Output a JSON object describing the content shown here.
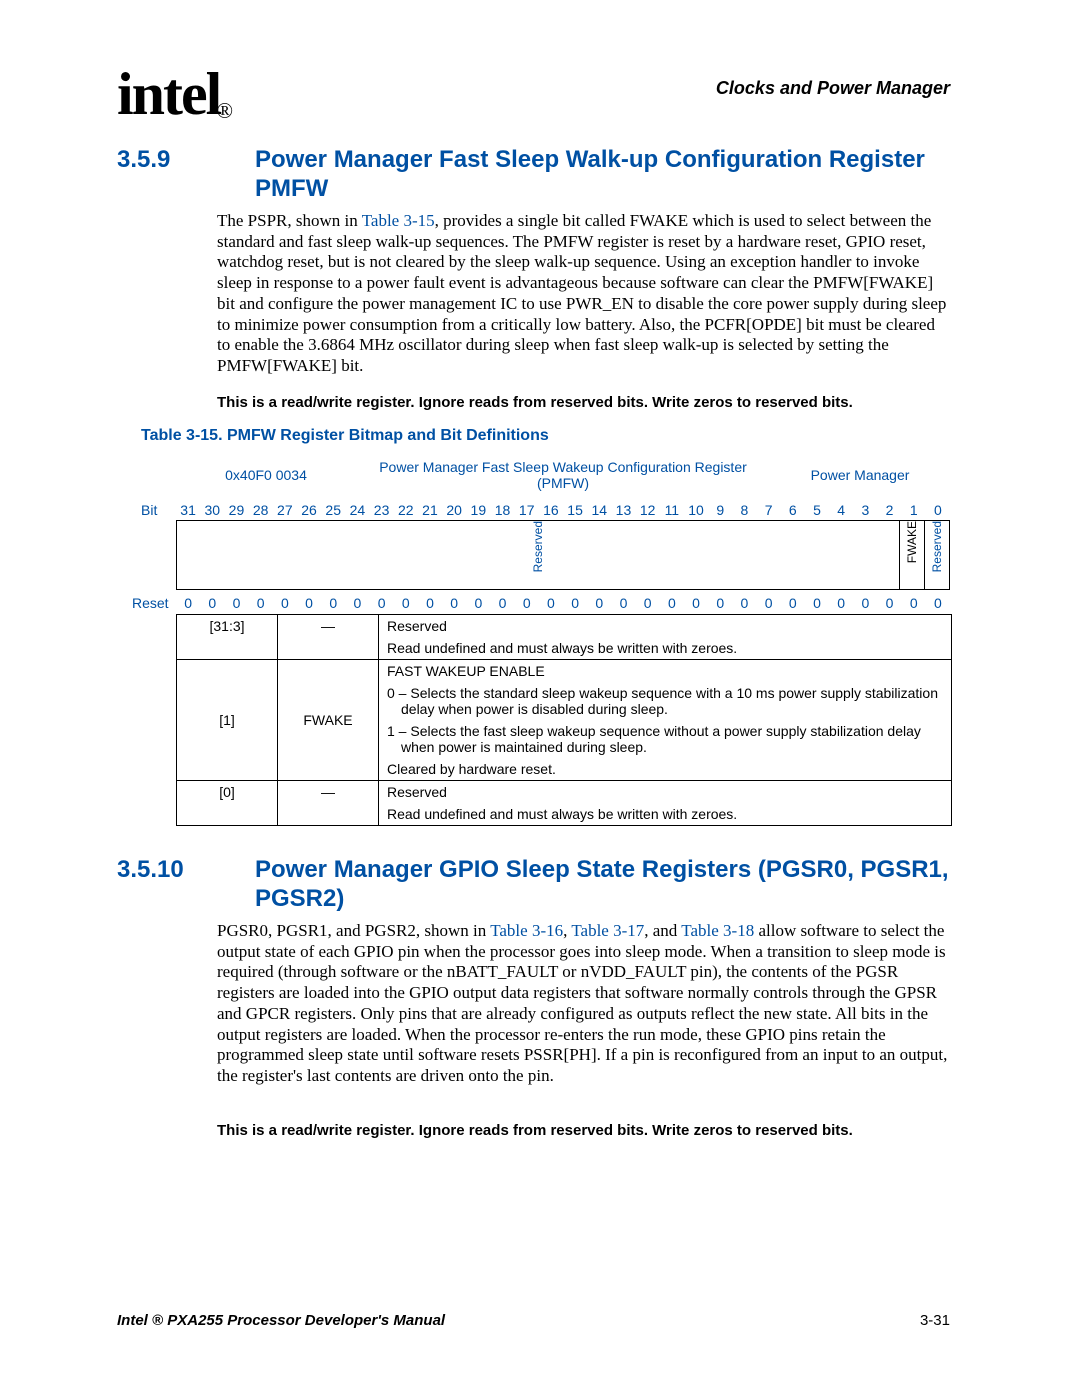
{
  "header": {
    "logo_main": "int",
    "logo_end": "e",
    "logo_l": "l",
    "reg_mark": "®",
    "section": "Clocks and Power Manager"
  },
  "sec1": {
    "num": "3.5.9",
    "title": "Power Manager Fast Sleep Walk-up Configuration Register PMFW",
    "p1a": "The PSPR, shown in ",
    "p1link": "Table 3-15",
    "p1b": ", provides a single bit called FWAKE which is used to select between the standard and fast sleep walk-up sequences. The PMFW register is reset by a hardware reset, GPIO reset, watchdog reset, but is not cleared by the sleep walk-up sequence. Using an exception handler to invoke sleep in response to a power fault event is advantageous because software can clear the PMFW[FWAKE] bit and configure the power management IC to use PWR_EN to disable the core power supply during sleep to minimize power consumption from a critically low battery. Also, the PCFR[OPDE] bit must be cleared to enable the 3.6864 MHz oscillator during sleep when fast sleep walk-up is selected by setting the PMFW[FWAKE] bit.",
    "note": "This is a read/write register. Ignore reads from reserved bits. Write zeros to reserved bits.",
    "table_caption": "Table 3-15. PMFW Register Bitmap and Bit Definitions"
  },
  "reg": {
    "address": "0x40F0 0034",
    "name": "Power Manager Fast Sleep Wakeup Configuration Register (PMFW)",
    "block": "Power Manager",
    "bit_label": "Bit",
    "bits": [
      "31",
      "30",
      "29",
      "28",
      "27",
      "26",
      "25",
      "24",
      "23",
      "22",
      "21",
      "20",
      "19",
      "18",
      "17",
      "16",
      "15",
      "14",
      "13",
      "12",
      "11",
      "10",
      "9",
      "8",
      "7",
      "6",
      "5",
      "4",
      "3",
      "2",
      "1",
      "0"
    ],
    "field_reserved": "Reserved",
    "field_fwake": "FWAKE",
    "field_reserved2": "Reserved",
    "reset_label": "Reset",
    "reset_vals": [
      "0",
      "0",
      "0",
      "0",
      "0",
      "0",
      "0",
      "0",
      "0",
      "0",
      "0",
      "0",
      "0",
      "0",
      "0",
      "0",
      "0",
      "0",
      "0",
      "0",
      "0",
      "0",
      "0",
      "0",
      "0",
      "0",
      "0",
      "0",
      "0",
      "0",
      "0",
      "0"
    ]
  },
  "defs": {
    "r1_bits": "[31:3]",
    "r1_name": "—",
    "r1_d1": "Reserved",
    "r1_d2": "Read undefined and must always be written with zeroes.",
    "r2_bits": "[1]",
    "r2_name": "FWAKE",
    "r2_t": "FAST WAKEUP ENABLE",
    "r2_l1": "0 – Selects the standard sleep wakeup sequence with a 10 ms power supply stabilization delay when power is disabled during sleep.",
    "r2_l2": "1 – Selects the fast sleep wakeup sequence without a power supply stabilization delay when power is maintained during sleep.",
    "r2_f": "Cleared by hardware reset.",
    "r3_bits": "[0]",
    "r3_name": "—",
    "r3_d1": "Reserved",
    "r3_d2": "Read undefined and must always be written with zeroes."
  },
  "sec2": {
    "num": "3.5.10",
    "title": "Power Manager GPIO Sleep State Registers (PGSR0, PGSR1, PGSR2)",
    "p1a": "PGSR0, PGSR1, and PGSR2, shown in ",
    "l1": "Table 3-16",
    "sep1": ", ",
    "l2": "Table 3-17",
    "sep2": ", and ",
    "l3": "Table 3-18",
    "p1b": " allow software to select the output state of each GPIO pin when the processor goes into sleep mode. When a transition to sleep mode is required (through software or the nBATT_FAULT or nVDD_FAULT pin), the contents of the PGSR registers are loaded into the GPIO output data registers that software normally controls through the GPSR and GPCR registers. Only pins that are already configured as outputs reflect the new state. All bits in the output registers are loaded. When the processor re-enters the run mode, these GPIO pins retain the programmed sleep state until software resets PSSR[PH]. If a pin is reconfigured from an input to an output, the register's last contents are driven onto the pin.",
    "note": "This is a read/write register. Ignore reads from reserved bits. Write zeros to reserved bits."
  },
  "footer": {
    "left": "Intel ® PXA255 Processor Developer's Manual",
    "right": "3-31"
  }
}
